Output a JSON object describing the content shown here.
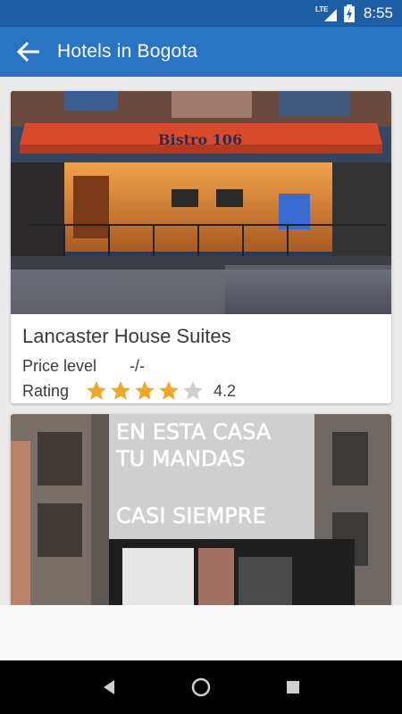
{
  "status_bar": {
    "network": "LTE",
    "time": "8:55"
  },
  "app_bar": {
    "back_icon": "arrow-back-icon",
    "title": "Hotels in Bogota"
  },
  "hotels": [
    {
      "name": "Lancaster House Suites",
      "price_label": "Price level",
      "price_value": "-/-",
      "rating_label": "Rating",
      "rating": 4.2,
      "rating_text": "4.2",
      "stars_filled": 4,
      "stars_total": 5,
      "photo_sign": "Bistro 106"
    },
    {
      "photo_text_line1": "EN ESTA CASA",
      "photo_text_line2": "TU MANDAS",
      "photo_text_line3": "CASI SIEMPRE"
    }
  ],
  "colors": {
    "status_bar": "#1d5ea6",
    "app_bar": "#2a74c2",
    "star_filled": "#f5a623",
    "star_empty": "#cfcfcf"
  },
  "nav": {
    "back": "nav-back-icon",
    "home": "nav-home-icon",
    "recents": "nav-recents-icon"
  }
}
